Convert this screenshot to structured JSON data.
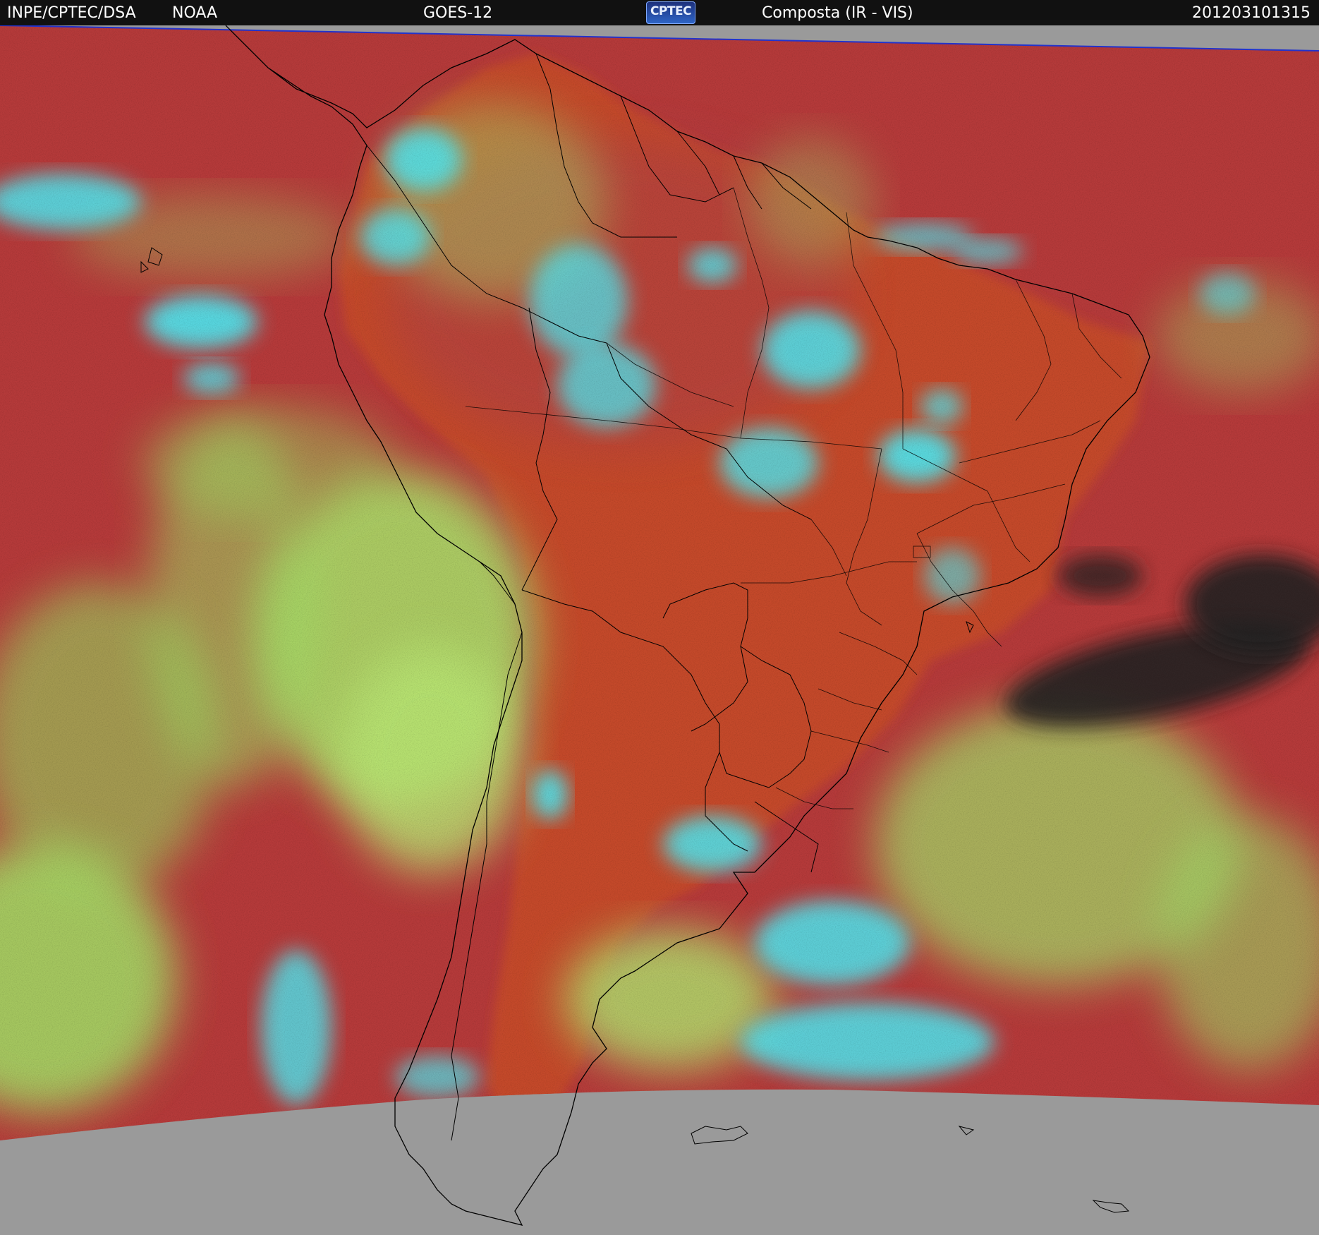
{
  "header": {
    "agency": "INPE/CPTEC/DSA",
    "source": "NOAA",
    "satellite": "GOES-12",
    "logo_text": "CPTEC",
    "product": "Composta (IR - VIS)",
    "timestamp": "201203101315"
  },
  "colors": {
    "header_bg": "#111111",
    "no_data_gray": "#9a9a9a",
    "clear_ocean": "#b53a3a",
    "clear_land": "#c44a2c",
    "low_cloud": "#a9e36a",
    "high_cloud": "#4ee6f0",
    "cold_dark_region": "#222222",
    "coastline": "#000000",
    "scan_edge": "#2233cc"
  },
  "map": {
    "region": "South America",
    "layers": [
      "coastlines",
      "country borders",
      "state borders"
    ]
  }
}
